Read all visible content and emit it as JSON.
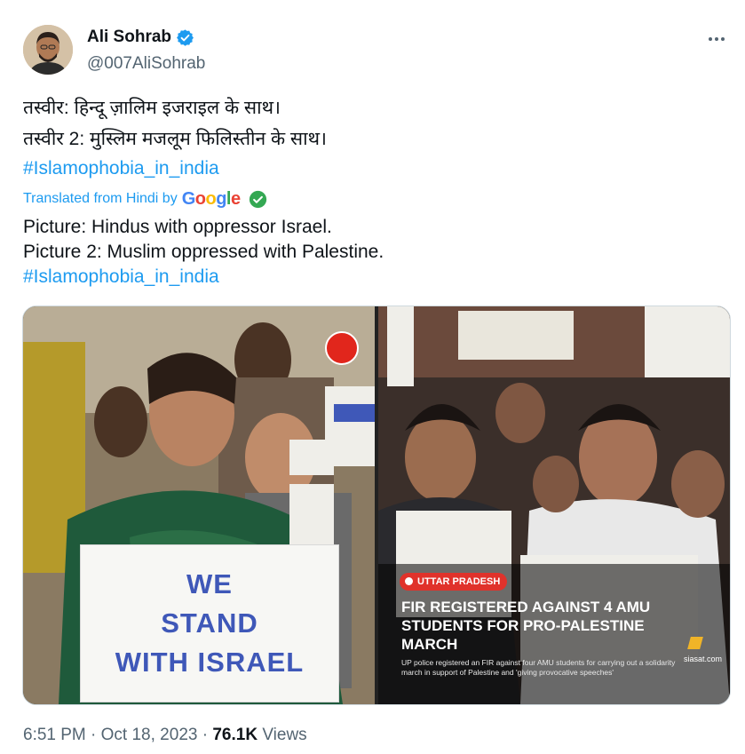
{
  "author": {
    "name": "Ali Sohrab",
    "handle": "@007AliSohrab",
    "verified": true
  },
  "tweet": {
    "line1": "तस्वीर: हिन्दू ज़ालिम इजराइल के साथ।",
    "line2": "तस्वीर 2: मुस्लिम मजलूम फिलिस्तीन के साथ।",
    "hashtag": "#Islamophobia_in_india"
  },
  "translation": {
    "label": "Translated from Hindi by",
    "provider": "Google",
    "line1": "Picture: Hindus with oppressor Israel.",
    "line2": "Picture 2: Muslim oppressed with Palestine.",
    "hashtag": "#Islamophobia_in_india"
  },
  "media": {
    "left_sign": [
      "WE",
      "STAND",
      "WITH ISRAEL"
    ],
    "right_badge": "UTTAR PRADESH",
    "right_headline": "FIR REGISTERED AGAINST 4 AMU STUDENTS FOR PRO-PALESTINE MARCH",
    "right_subtext": "UP police registered an FIR against four AMU students for carrying out a solidarity march in support of Palestine and 'giving provocative speeches'",
    "right_source": "siasat.com"
  },
  "footer": {
    "time": "6:51 PM",
    "separator": "·",
    "date": "Oct 18, 2023",
    "views_count": "76.1K",
    "views_label": "Views"
  },
  "colors": {
    "link": "#1d9bf0",
    "muted": "#536471",
    "text": "#0f1419",
    "verified_badge": "#1d9bf0",
    "sign_text": "#3f58b8",
    "news_badge": "#e0322b"
  },
  "icons": {
    "verified": "verified-badge-icon",
    "more": "more-options-icon",
    "check": "check-circle-icon"
  }
}
